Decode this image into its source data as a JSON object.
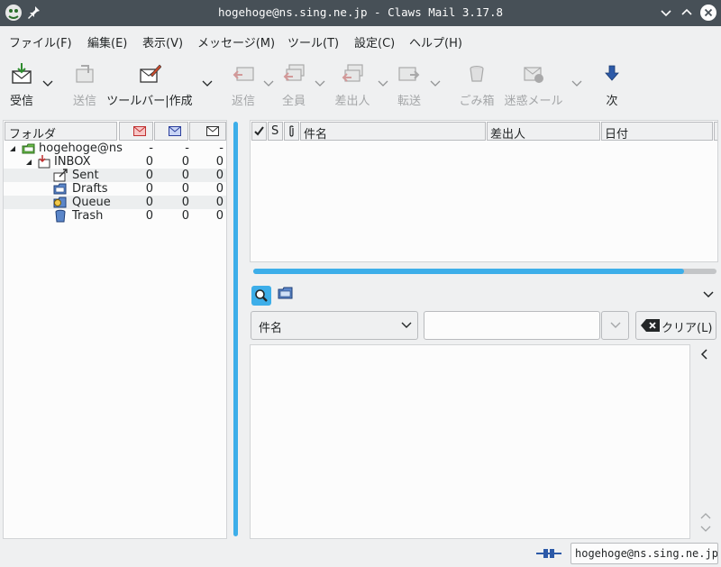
{
  "window": {
    "title": "hogehoge@ns.sing.ne.jp - Claws Mail 3.17.8"
  },
  "menu": [
    "ファイル(F)",
    "編集(E)",
    "表示(V)",
    "メッセージ(M)",
    "ツール(T)",
    "設定(C)",
    "ヘルプ(H)"
  ],
  "toolbar": {
    "receive": "受信",
    "send": "送信",
    "compose": "ツールバー|作成",
    "reply": "返信",
    "reply_all": "全員",
    "reply_sender": "差出人",
    "forward": "転送",
    "trash": "ごみ箱",
    "spam": "迷惑メール",
    "next": "次"
  },
  "folder_pane": {
    "header": "フォルダ",
    "folders": [
      {
        "name": "hogehoge@ns",
        "unread": "-",
        "new": "-",
        "total": "-",
        "icon": "mailbox-icon"
      },
      {
        "name": "INBOX",
        "unread": "0",
        "new": "0",
        "total": "0",
        "icon": "inbox-icon"
      },
      {
        "name": "Sent",
        "unread": "0",
        "new": "0",
        "total": "0",
        "icon": "sent-folder-icon"
      },
      {
        "name": "Drafts",
        "unread": "0",
        "new": "0",
        "total": "0",
        "icon": "drafts-folder-icon"
      },
      {
        "name": "Queue",
        "unread": "0",
        "new": "0",
        "total": "0",
        "icon": "queue-folder-icon"
      },
      {
        "name": "Trash",
        "unread": "0",
        "new": "0",
        "total": "0",
        "icon": "trash-folder-icon"
      }
    ]
  },
  "message_list": {
    "columns": {
      "status": "S",
      "subject": "件名",
      "from": "差出人",
      "date": "日付"
    }
  },
  "progress": {
    "fraction": 0.93
  },
  "quick_search": {
    "field": "件名",
    "query": "",
    "clear_label": "クリア(L)"
  },
  "statusbar": {
    "account": "hogehoge@ns.sing.ne.jp"
  },
  "colors": {
    "accent": "#3daee9",
    "titlebar": "#475057"
  }
}
